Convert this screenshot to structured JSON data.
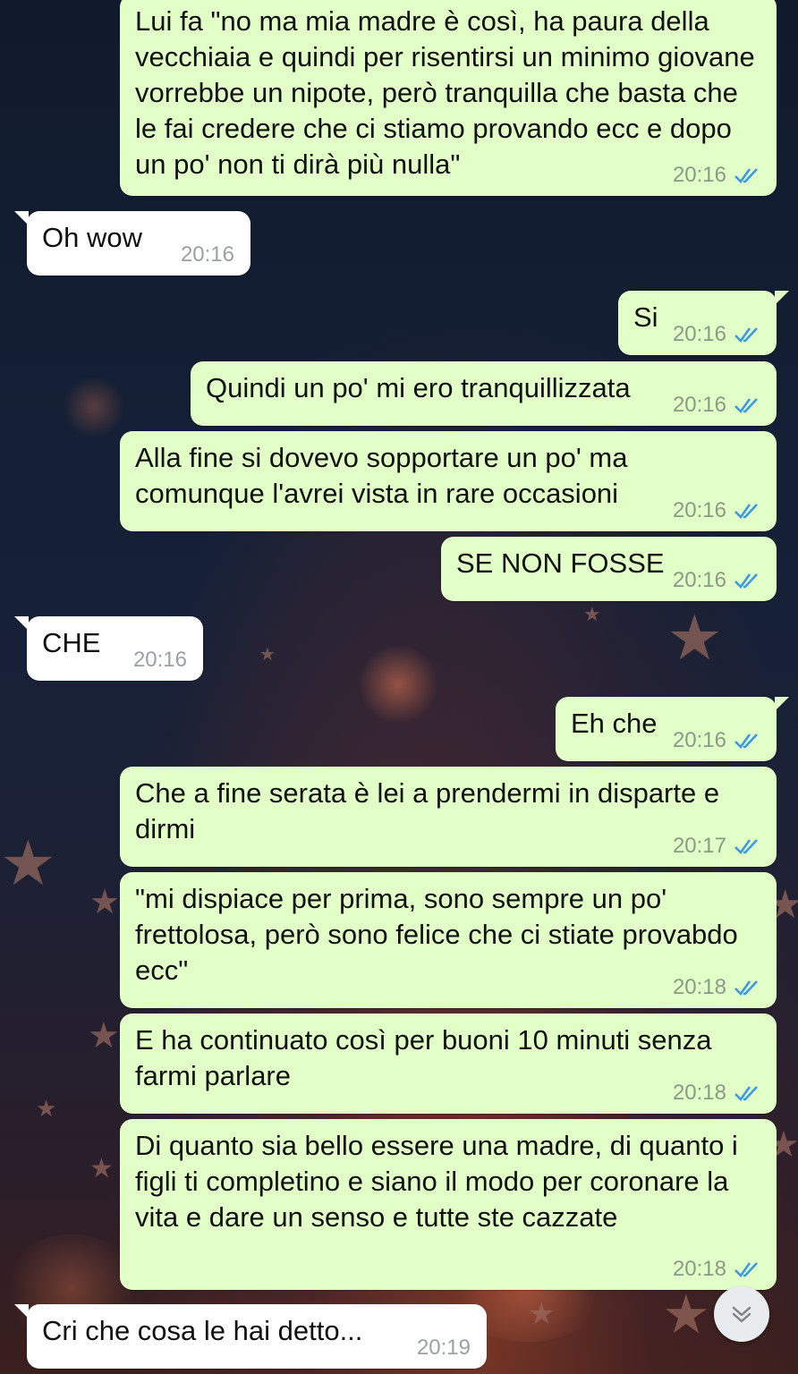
{
  "colors": {
    "outgoing_bubble": "#e2ffc7",
    "incoming_bubble": "#ffffff",
    "read_ticks": "#3b9ae1",
    "timestamp": "#8a9a86"
  },
  "icons": {
    "read_receipt": "double-check-icon",
    "scroll_down": "chevron-down-icon"
  },
  "messages": [
    {
      "direction": "out",
      "text": "Lui fa \"no ma mia madre è così, ha paura della vecchiaia e quindi per risentirsi un minimo giovane vorrebbe un nipote, però tranquilla che basta che le fai credere che ci stiamo provando ecc e dopo un po' non ti dirà più nulla\"",
      "time": "20:16",
      "read": true
    },
    {
      "direction": "in",
      "text": "Oh wow",
      "time": "20:16"
    },
    {
      "direction": "out",
      "text": "Si",
      "time": "20:16",
      "read": true
    },
    {
      "direction": "out",
      "text": "Quindi un po' mi ero tranquillizzata",
      "time": "20:16",
      "read": true
    },
    {
      "direction": "out",
      "text": "Alla fine si dovevo sopportare un po' ma comunque l'avrei vista in rare occasioni",
      "time": "20:16",
      "read": true
    },
    {
      "direction": "out",
      "text": "SE NON FOSSE",
      "time": "20:16",
      "read": true
    },
    {
      "direction": "in",
      "text": "CHE",
      "time": "20:16"
    },
    {
      "direction": "out",
      "text": "Eh che",
      "time": "20:16",
      "read": true
    },
    {
      "direction": "out",
      "text": "Che a fine serata è lei a prendermi in disparte e dirmi",
      "time": "20:17",
      "read": true
    },
    {
      "direction": "out",
      "text": "\"mi dispiace per prima, sono sempre un po' frettolosa, però sono felice che ci stiate provabdo ecc\"",
      "time": "20:18",
      "read": true
    },
    {
      "direction": "out",
      "text": "E ha continuato così per buoni 10 minuti senza farmi parlare",
      "time": "20:18",
      "read": true
    },
    {
      "direction": "out",
      "text": "Di quanto sia bello essere una madre, di quanto i figli ti completino e siano il modo per coronare la vita e dare un senso e tutte ste cazzate",
      "time": "20:18",
      "read": true
    },
    {
      "direction": "in",
      "text": "Cri che cosa le hai detto...",
      "time": "20:19"
    }
  ]
}
